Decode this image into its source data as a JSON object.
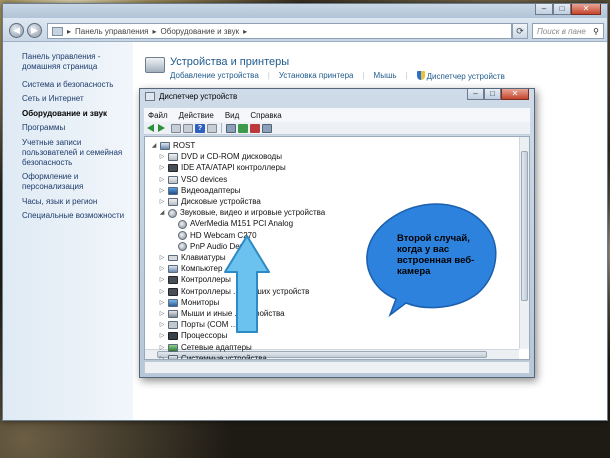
{
  "control_panel": {
    "breadcrumb": [
      "Панель управления",
      "Оборудование и звук"
    ],
    "search_placeholder": "Поиск в пане",
    "sidebar": {
      "items": [
        {
          "label": "Панель управления - домашняя страница",
          "active": false
        },
        {
          "label": "Система и безопасность",
          "active": false
        },
        {
          "label": "Сеть и Интернет",
          "active": false
        },
        {
          "label": "Оборудование и звук",
          "active": true
        },
        {
          "label": "Программы",
          "active": false
        },
        {
          "label": "Учетные записи пользователей и семейная безопасность",
          "active": false
        },
        {
          "label": "Оформление и персонализация",
          "active": false
        },
        {
          "label": "Часы, язык и регион",
          "active": false
        },
        {
          "label": "Специальные возможности",
          "active": false
        }
      ]
    },
    "section": {
      "title": "Устройства и принтеры",
      "links": [
        "Добавление устройства",
        "Установка принтера",
        "Мышь",
        "Диспетчер устройств"
      ]
    }
  },
  "device_manager": {
    "title": "Диспетчер устройств",
    "menu": [
      "Файл",
      "Действие",
      "Вид",
      "Справка"
    ],
    "tree": [
      {
        "label": "ROST",
        "level": 0,
        "expanded": true,
        "icon": "computer"
      },
      {
        "label": "DVD и CD-ROM дисководы",
        "level": 1,
        "expanded": false,
        "icon": "drive"
      },
      {
        "label": "IDE ATA/ATAPI контроллеры",
        "level": 1,
        "expanded": false,
        "icon": "chip"
      },
      {
        "label": "VSO devices",
        "level": 1,
        "expanded": false,
        "icon": "drive"
      },
      {
        "label": "Видеоадаптеры",
        "level": 1,
        "expanded": false,
        "icon": "display"
      },
      {
        "label": "Дисковые устройства",
        "level": 1,
        "expanded": false,
        "icon": "drive"
      },
      {
        "label": "Звуковые, видео и игровые устройства",
        "level": 1,
        "expanded": true,
        "icon": "sound"
      },
      {
        "label": "AVerMedia M151 PCI Analog",
        "level": 2,
        "expanded": null,
        "icon": "sound"
      },
      {
        "label": "HD Webcam C270",
        "level": 2,
        "expanded": null,
        "icon": "sound"
      },
      {
        "label": "PnP Audio Device",
        "level": 2,
        "expanded": null,
        "icon": "sound"
      },
      {
        "label": "Клавиатуры",
        "level": 1,
        "expanded": false,
        "icon": "keyboard"
      },
      {
        "label": "Компьютер",
        "level": 1,
        "expanded": false,
        "icon": "computer"
      },
      {
        "label": "Контроллеры",
        "level": 1,
        "expanded": false,
        "icon": "chip"
      },
      {
        "label": "Контроллеры ... инаших устройств",
        "level": 1,
        "expanded": false,
        "icon": "chip"
      },
      {
        "label": "Мониторы",
        "level": 1,
        "expanded": false,
        "icon": "monitor"
      },
      {
        "label": "Мыши и иные ... устройства",
        "level": 1,
        "expanded": false,
        "icon": "sys"
      },
      {
        "label": "Порты (COM ...)",
        "level": 1,
        "expanded": false,
        "icon": "port"
      },
      {
        "label": "Процессоры",
        "level": 1,
        "expanded": false,
        "icon": "cpu"
      },
      {
        "label": "Сетевые адаптеры",
        "level": 1,
        "expanded": false,
        "icon": "net"
      },
      {
        "label": "Системные устройства",
        "level": 1,
        "expanded": false,
        "icon": "sys"
      }
    ]
  },
  "annotation": {
    "callout_text": "Второй случай, когда у вас встроенная веб-камера",
    "arrow_color": "#6cc2ee",
    "callout_color": "#2d82de"
  }
}
